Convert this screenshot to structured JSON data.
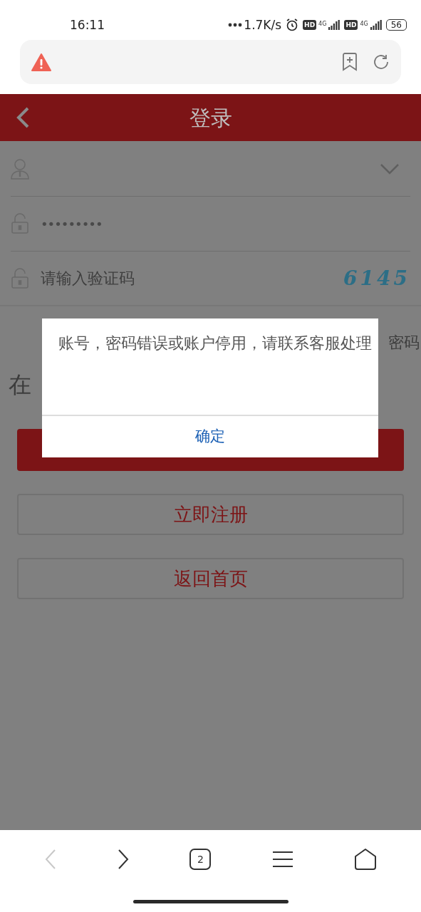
{
  "status_bar": {
    "time": "16:11",
    "net_speed": "1.7K/s",
    "signals": [
      {
        "hd": "HD",
        "network": "4G"
      },
      {
        "hd": "HD",
        "network": "4G"
      }
    ],
    "battery": "56"
  },
  "header": {
    "title": "登录"
  },
  "form": {
    "password": {
      "value": "•••••••••"
    },
    "captcha": {
      "placeholder": "请输入验证码",
      "code": "6145"
    }
  },
  "partial_texts": {
    "left": "在",
    "right": "密码"
  },
  "buttons": [
    {
      "label": "立即注册"
    },
    {
      "label": "返回首页"
    }
  ],
  "dialog": {
    "message": "账号，密码错误或账户停用，请联系客服处理",
    "confirm": "确定"
  },
  "bottom_nav": {
    "tab_count": "2",
    "back_disabled": true
  }
}
